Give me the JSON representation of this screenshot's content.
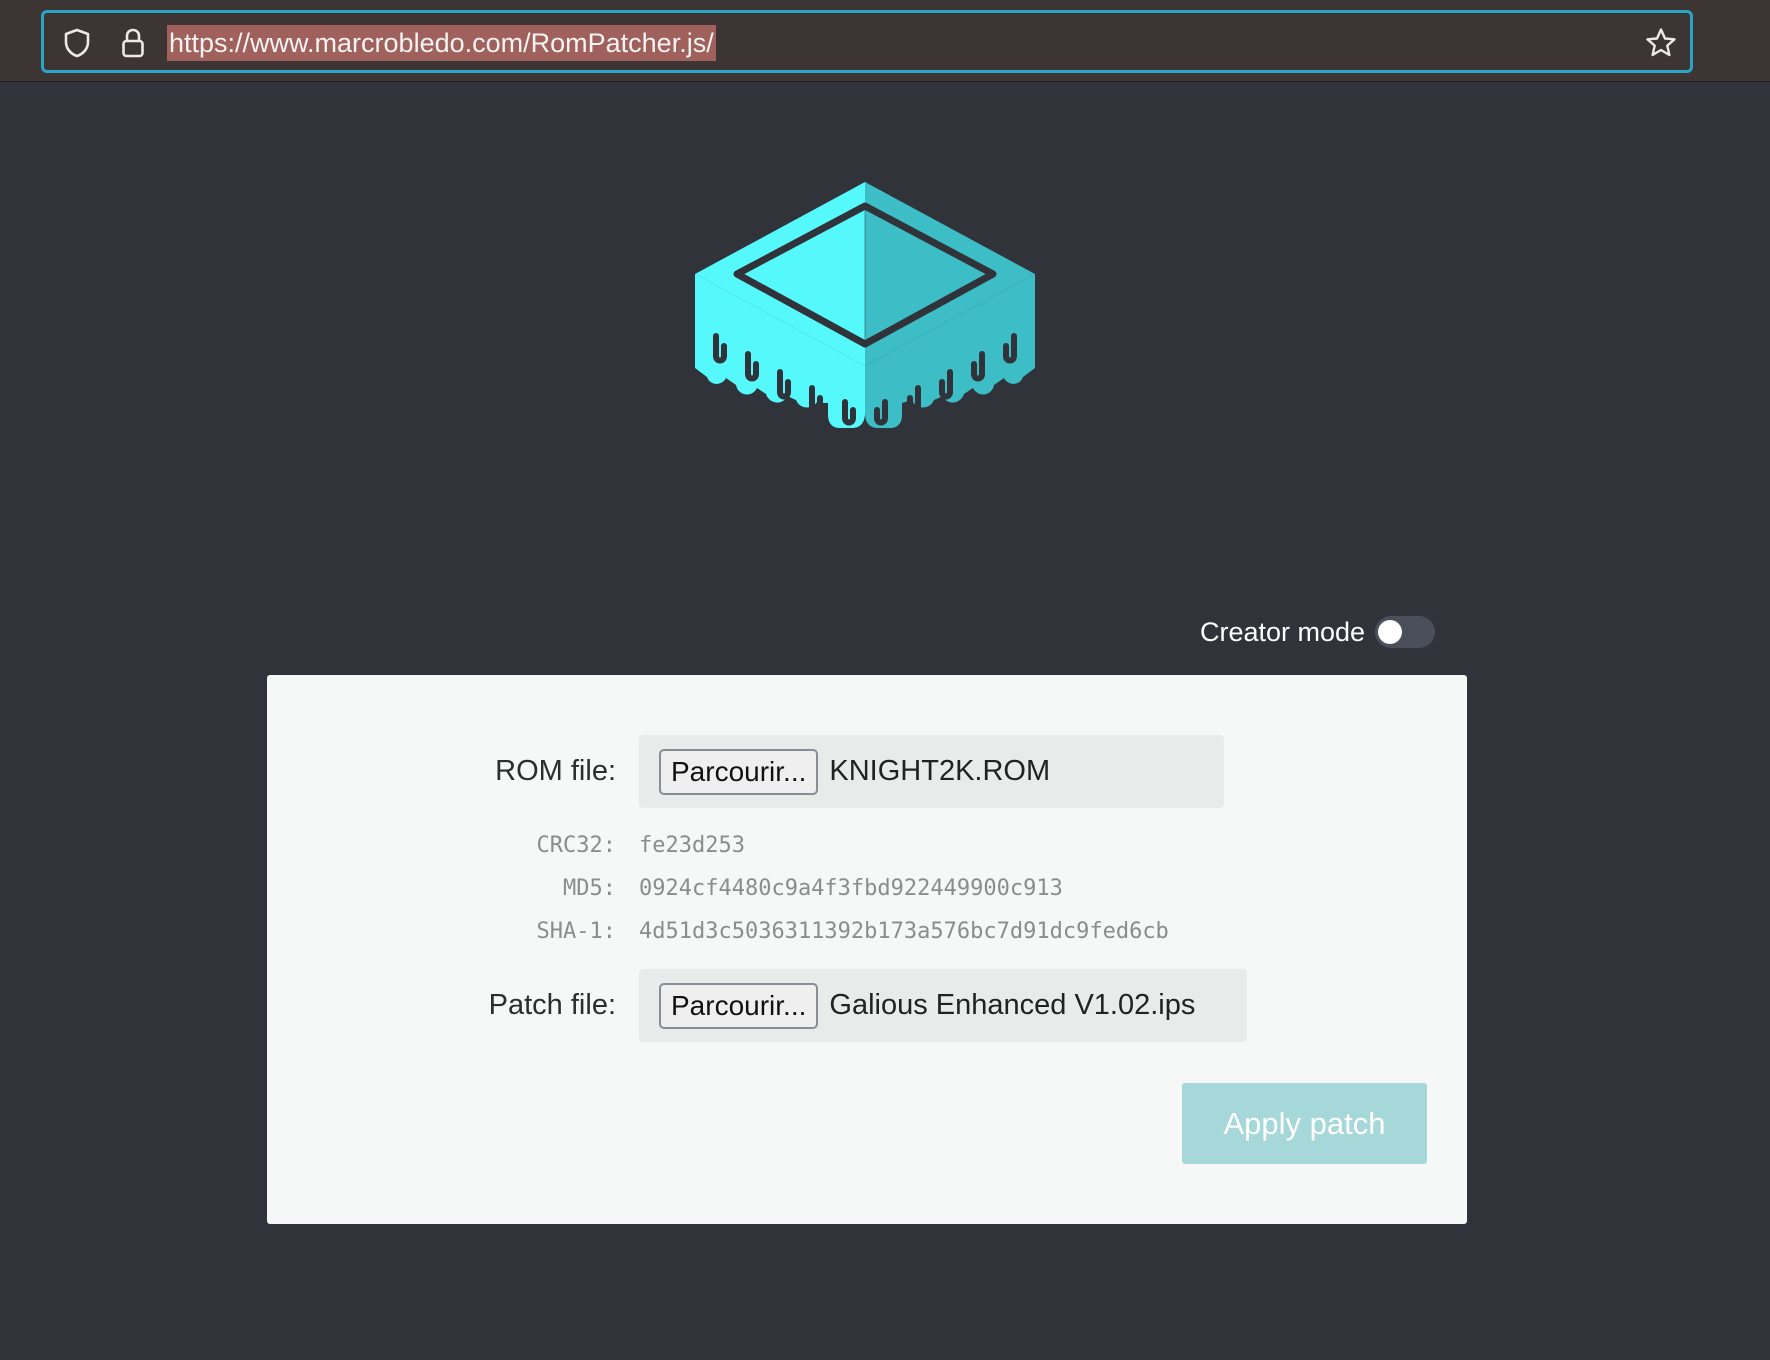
{
  "browser": {
    "url": "https://www.marcrobledo.com/RomPatcher.js/",
    "icons": [
      "shield-icon",
      "lock-icon",
      "star-icon"
    ]
  },
  "logo": {
    "icon": "rom-chip-logo",
    "colors": {
      "light": "#55f9fc",
      "dark": "#3dbdc5",
      "outline": "#30333a"
    }
  },
  "creator_mode": {
    "label": "Creator mode",
    "enabled": false
  },
  "form": {
    "rom_file": {
      "label": "ROM file:",
      "button_label": "Parcourir...",
      "file_name": "KNIGHT2K.ROM"
    },
    "hashes": [
      {
        "label": "CRC32:",
        "value": "fe23d253"
      },
      {
        "label": "MD5:",
        "value": "0924cf4480c9a4f3fbd922449900c913"
      },
      {
        "label": "SHA-1:",
        "value": "4d51d3c5036311392b173a576bc7d91dc9fed6cb"
      }
    ],
    "patch_file": {
      "label": "Patch file:",
      "button_label": "Parcourir...",
      "file_name": "Galious Enhanced V1.02.ips"
    },
    "apply_button": "Apply patch"
  },
  "colors": {
    "background": "#30333a",
    "toolbar": "#3c3533",
    "url_focus_border": "#29a5c8",
    "url_selection": "#a0605c",
    "card": "#f6f7f7",
    "apply_button_disabled": "#a6d8da"
  }
}
